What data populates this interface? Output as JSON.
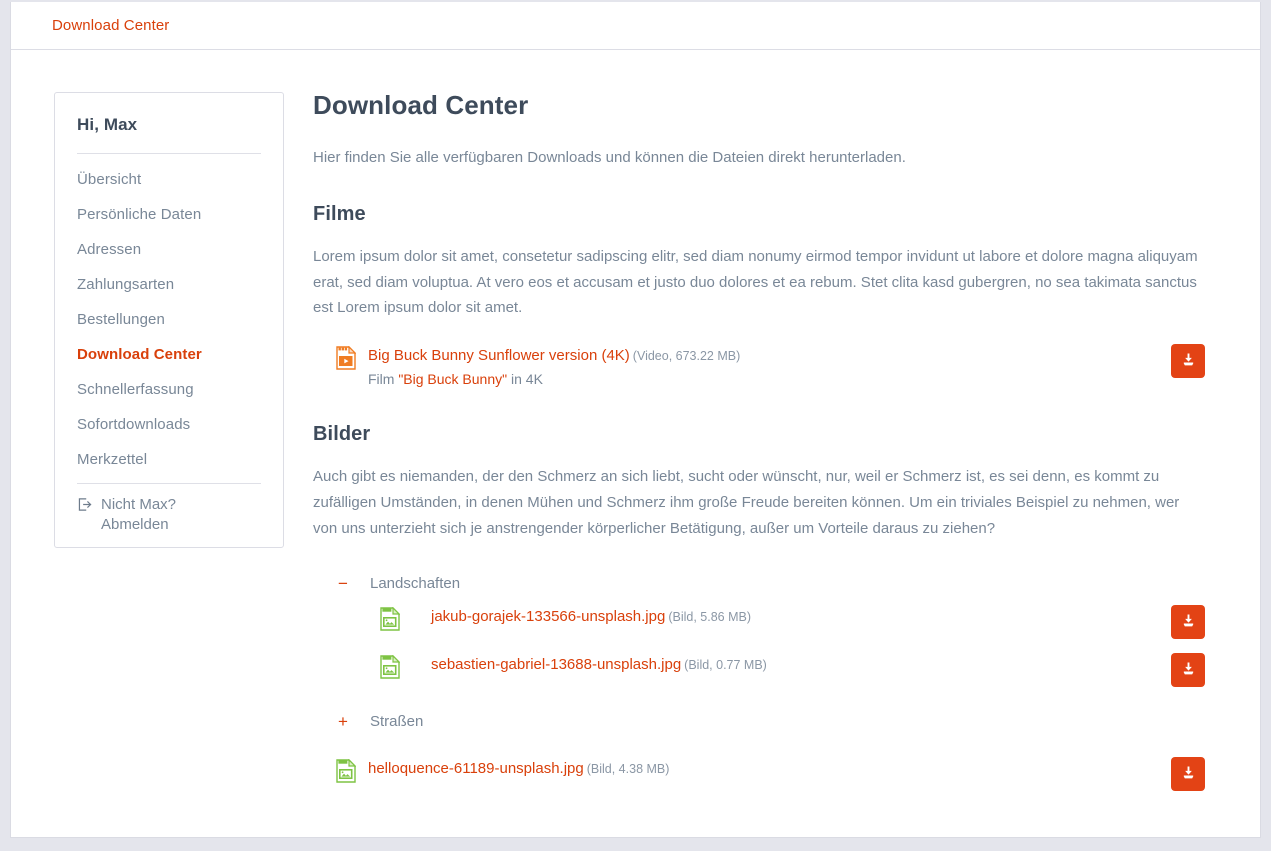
{
  "topbar": {
    "link_label": "Download Center"
  },
  "sidebar": {
    "greeting": "Hi, Max",
    "items": [
      {
        "label": "Übersicht",
        "active": false
      },
      {
        "label": "Persönliche Daten",
        "active": false
      },
      {
        "label": "Adressen",
        "active": false
      },
      {
        "label": "Zahlungsarten",
        "active": false
      },
      {
        "label": "Bestellungen",
        "active": false
      },
      {
        "label": "Download Center",
        "active": true
      },
      {
        "label": "Schnellerfassung",
        "active": false
      },
      {
        "label": "Sofortdownloads",
        "active": false
      },
      {
        "label": "Merkzettel",
        "active": false
      }
    ],
    "logout_question": "Nicht Max?",
    "logout_action": "Abmelden",
    "logout_icon": "sign-out-icon"
  },
  "main": {
    "title": "Download Center",
    "intro": "Hier finden Sie alle verfügbaren Downloads und können die Dateien direkt herunterladen.",
    "sections": [
      {
        "title": "Filme",
        "text": "Lorem ipsum dolor sit amet, consetetur sadipscing elitr, sed diam nonumy eirmod tempor invidunt ut labore et dolore magna aliquyam erat, sed diam voluptua. At vero eos et accusam et justo duo dolores et ea rebum. Stet clita kasd gubergren, no sea takimata sanctus est Lorem ipsum dolor sit amet."
      },
      {
        "title": "Bilder",
        "text": "Auch gibt es niemanden, der den Schmerz an sich liebt, sucht oder wünscht, nur, weil er Schmerz ist, es sei denn, es kommt zu zufälligen Umständen, in denen Mühen und Schmerz ihm große Freude bereiten können. Um ein triviales Beispiel zu nehmen, wer von uns unterzieht sich je anstrengender körperlicher Betätigung, außer um Vorteile daraus zu ziehen?"
      }
    ]
  },
  "films": {
    "rows": [
      {
        "icon": "video-file-icon",
        "icon_kind": "video",
        "name": "Big Buck Bunny Sunflower version (4K)",
        "info": "(Video, 673.22 MB)",
        "desc_pre": "Film ",
        "desc_quoted": "\"Big Buck Bunny\"",
        "desc_post": " in 4K",
        "download_button": "download-button",
        "download_icon": "download-icon"
      }
    ]
  },
  "images": {
    "folders": [
      {
        "toggle": "−",
        "expanded": true,
        "label": "Landschaften",
        "toggle_name": "folder-collapse-toggle",
        "files": [
          {
            "icon": "jpg-file-icon",
            "icon_kind": "image",
            "icon_label": "JPG",
            "name": "jakub-gorajek-133566-unsplash.jpg",
            "info": "(Bild, 5.86 MB)",
            "download_button": "download-button",
            "download_icon": "download-icon"
          },
          {
            "icon": "jpg-file-icon",
            "icon_kind": "image",
            "icon_label": "JPG",
            "name": "sebastien-gabriel-13688-unsplash.jpg",
            "info": "(Bild, 0.77 MB)",
            "download_button": "download-button",
            "download_icon": "download-icon"
          }
        ]
      },
      {
        "toggle": "+",
        "expanded": false,
        "label": "Straßen",
        "toggle_name": "folder-expand-toggle",
        "files": []
      }
    ],
    "loose_files": [
      {
        "icon": "jpg-file-icon",
        "icon_kind": "image",
        "icon_label": "JPG",
        "name": "helloquence-61189-unsplash.jpg",
        "info": "(Bild, 4.38 MB)",
        "download_button": "download-button",
        "download_icon": "download-icon"
      }
    ]
  },
  "colors": {
    "accent": "#d9400b",
    "button": "#e34315",
    "heading": "#3e4b5b",
    "body_text": "#798797",
    "page_bg": "#e4e5ec",
    "card_border": "#dcdde5",
    "image_icon": "#7ec343",
    "video_icon": "#f07c22"
  }
}
